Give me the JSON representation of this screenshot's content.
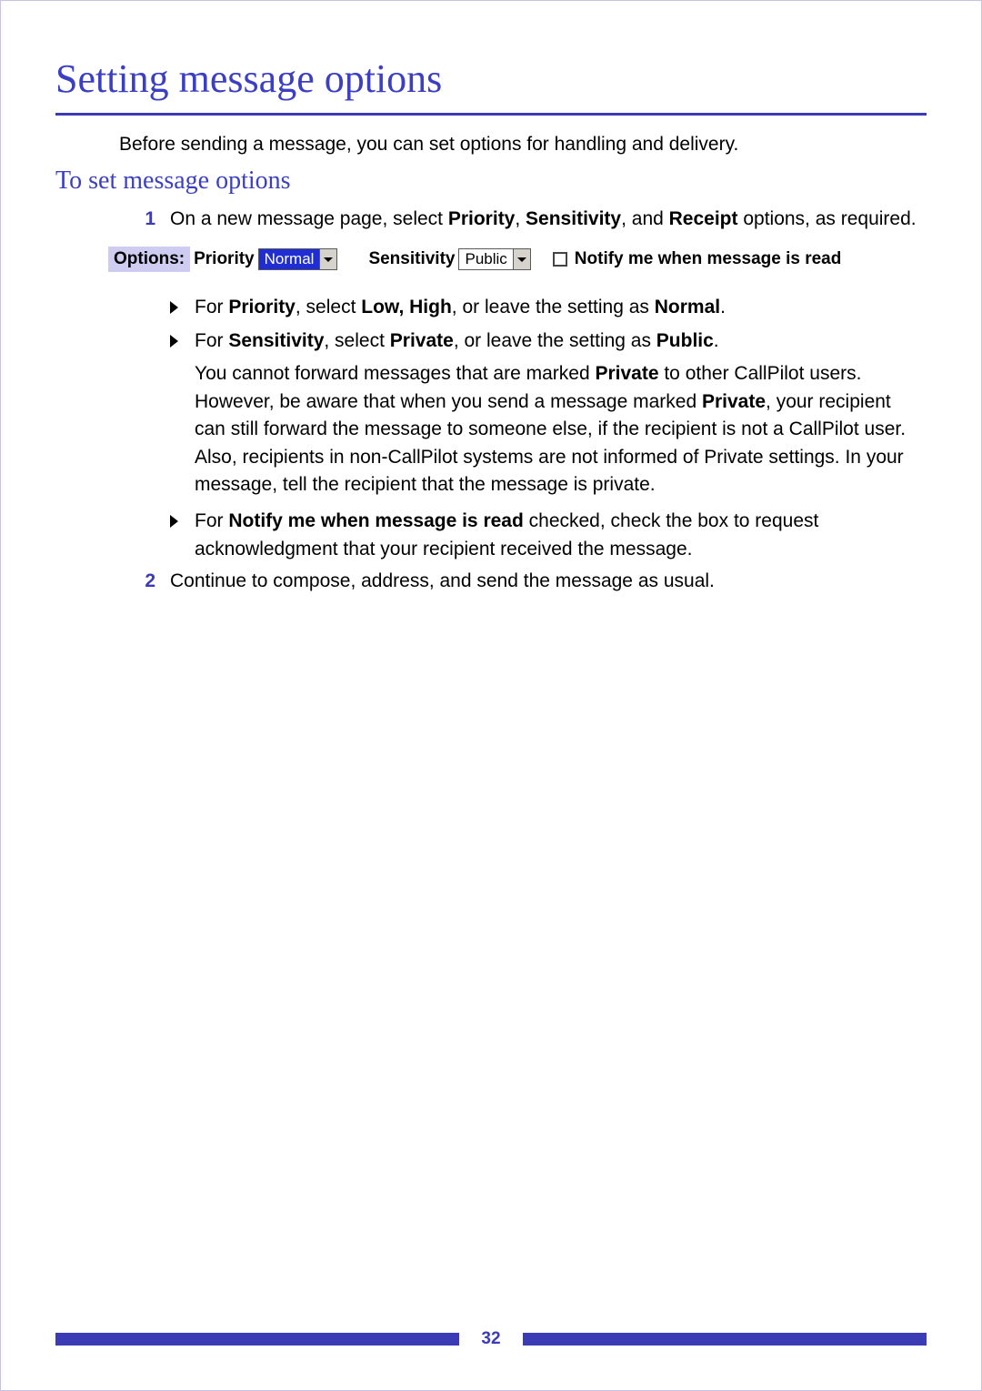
{
  "title": "Setting message options",
  "intro": "Before sending a message, you can set options for handling and delivery.",
  "section": "To set message options",
  "step1": {
    "num": "1",
    "lead": "On a new message page, select ",
    "b1": "Priority",
    "sep1": ", ",
    "b2": "Sensitivity",
    "sep2": ", and ",
    "b3": "Receipt",
    "tail": " options, as required."
  },
  "options": {
    "label": "Options:",
    "priority_label": "Priority",
    "priority_value": "Normal",
    "sensitivity_label": "Sensitivity",
    "sensitivity_value": "Public",
    "notify": "Notify me when message is read"
  },
  "bul1": {
    "a": "For ",
    "b1": "Priority",
    "b": ", select ",
    "b2": "Low, High",
    "c": ", or leave the setting as ",
    "b3": "Normal",
    "d": "."
  },
  "bul2": {
    "a": "For ",
    "b1": "Sensitivity",
    "b": ", select ",
    "b2": "Private",
    "c": ", or leave the setting as ",
    "b3": "Public",
    "d": "."
  },
  "sens_para_a": "You cannot forward messages that are marked ",
  "sens_para_b1": "Private",
  "sens_para_b": " to other CallPilot users. However, be aware that when you send a message marked ",
  "sens_para_b2": "Private",
  "sens_para_c": ", your recipient can still forward the message to someone else, if the recipient is not a CallPilot user. Also, recipients in non-CallPilot systems are not informed of Private settings. In your message, tell the recipient that the message is private.",
  "bul3": {
    "a": "For ",
    "b1": "Notify me when message is read",
    "b": " checked, check the box to request acknowledgment that your recipient received the message."
  },
  "step2": {
    "num": "2",
    "text": "Continue to compose, address, and send the message as usual."
  },
  "page_number": "32"
}
